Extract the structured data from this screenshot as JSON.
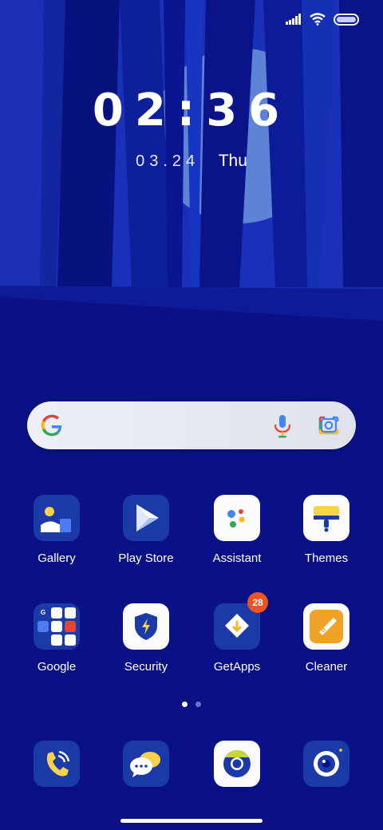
{
  "clock": {
    "h1": "0",
    "h2": "2",
    "sep": ":",
    "m1": "3",
    "m2": "6"
  },
  "date": {
    "date": "03.24",
    "weekday": "Thu"
  },
  "apps_row1": [
    {
      "label": "Gallery"
    },
    {
      "label": "Play Store"
    },
    {
      "label": "Assistant"
    },
    {
      "label": "Themes"
    }
  ],
  "apps_row2": [
    {
      "label": "Google"
    },
    {
      "label": "Security"
    },
    {
      "label": "GetApps",
      "badge": "28"
    },
    {
      "label": "Cleaner"
    }
  ],
  "dock": [
    {
      "icon": "phone-icon"
    },
    {
      "icon": "messages-icon"
    },
    {
      "icon": "chrome-icon"
    },
    {
      "icon": "camera-icon"
    }
  ],
  "page_indicator": {
    "pages": 2,
    "current": 1
  },
  "colors": {
    "background": "#0a1187",
    "accent": "#1b3aa8",
    "badge": "#ef5322"
  }
}
